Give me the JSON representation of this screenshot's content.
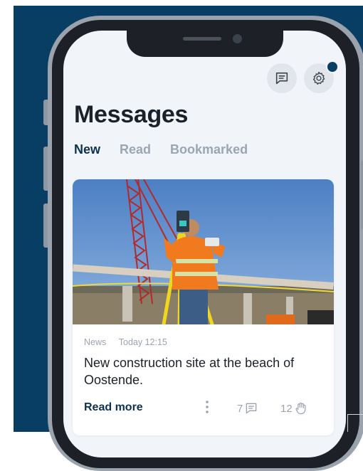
{
  "header": {
    "title": "Messages",
    "chat_icon": "chat-icon",
    "settings_icon": "gear-icon"
  },
  "tabs": [
    {
      "label": "New",
      "active": true
    },
    {
      "label": "Read",
      "active": false
    },
    {
      "label": "Bookmarked",
      "active": false
    }
  ],
  "card": {
    "image": "construction-surveyor-photo",
    "category": "News",
    "timestamp": "Today 12:15",
    "headline": "New construction site at the beach of Oostende.",
    "read_more": "Read more",
    "comments": "7",
    "reactions": "12"
  },
  "colors": {
    "background": "#083e63",
    "screen": "#f1f4f8",
    "accent": "#0d3250",
    "muted": "#9ba6b3"
  }
}
